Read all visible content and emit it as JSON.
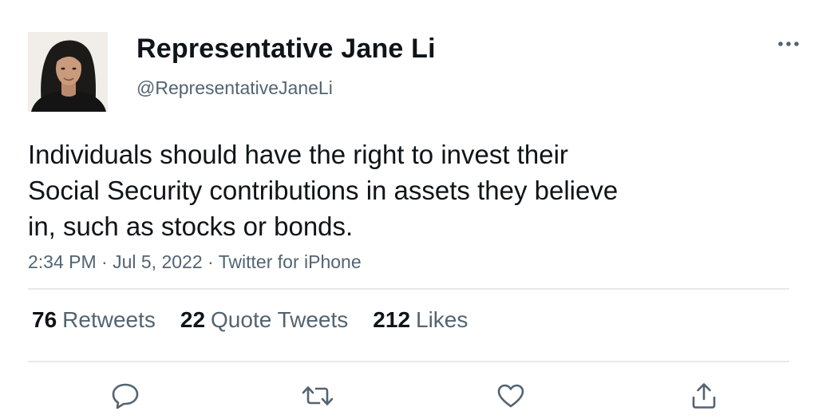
{
  "author": {
    "display_name": "Representative Jane Li",
    "handle": "@RepresentativeJaneLi"
  },
  "tweet": {
    "lines": [
      "Individuals should have the right to invest their",
      "Social Security contributions in assets they believe",
      "in, such as stocks or bonds."
    ],
    "meta": "2:34 PM · Jul 5, 2022 · Twitter for iPhone"
  },
  "stats": [
    {
      "count": "76",
      "label": "Retweets"
    },
    {
      "count": "22",
      "label": "Quote Tweets"
    },
    {
      "count": "212",
      "label": "Likes"
    }
  ],
  "icons": {
    "more": "more-horizontal-icon",
    "reply": "reply-icon",
    "retweet": "retweet-icon",
    "like": "heart-icon",
    "share": "share-icon"
  },
  "colors": {
    "text": "#0f1419",
    "secondary": "#536471",
    "divider": "#e6e8ea"
  }
}
